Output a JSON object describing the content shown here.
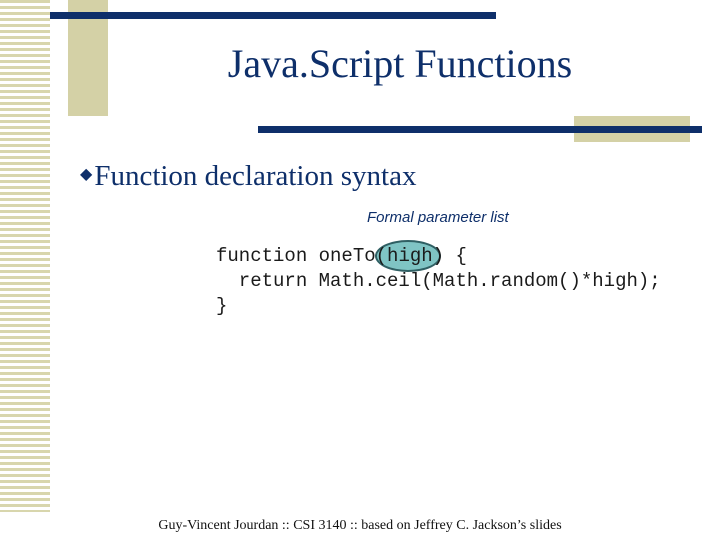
{
  "slide": {
    "title": "Java.Script Functions",
    "bullet": {
      "icon": "diamond-bullet",
      "text": "Function declaration syntax"
    },
    "annotation": "Formal parameter list",
    "code": {
      "line1_prefix": "function oneTo",
      "line1_param": "(high)",
      "line1_suffix": " {",
      "line2": "  return Math.ceil(Math.random()*high);",
      "line3": "}"
    },
    "footer": "Guy-Vincent Jourdan :: CSI 3140 :: based on Jeffrey C. Jackson’s slides"
  },
  "colors": {
    "title": "#0e2f6a",
    "accent_bar": "#0e2f6a",
    "decor_block": "#d4d1a6",
    "highlight": "#7fc4c4"
  }
}
